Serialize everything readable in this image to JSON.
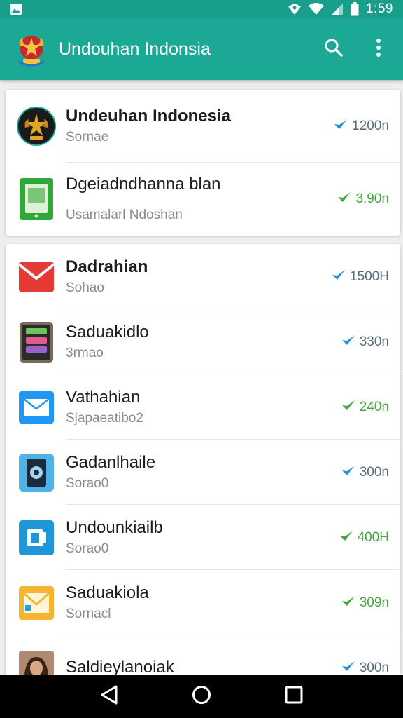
{
  "status_bar": {
    "time": "1:59"
  },
  "app_bar": {
    "title": "Undouhan Indonsia",
    "actions": [
      "search-icon",
      "more-vert-icon"
    ]
  },
  "colors": {
    "app_bar": "#1ba995",
    "status_bar": "#1a9e8c",
    "blue_check": "#2b8fd6",
    "green_check": "#43a53a"
  },
  "card_1": {
    "items": [
      {
        "title": "Undeuhan Indonesia",
        "subtitle": "Sornae",
        "meta": "1200n",
        "status": "blue",
        "icon": "emblem-icon"
      },
      {
        "title": "Dgeiadndhanna blan",
        "subtitle": "Usamalarl Ndoshan",
        "meta": "3.90n",
        "status": "green",
        "icon": "phone-app-icon"
      }
    ]
  },
  "card_2": {
    "items": [
      {
        "title": "Dadrahian",
        "subtitle": "Sohao",
        "meta": "1500H",
        "status": "blue",
        "icon": "mail-red-icon"
      },
      {
        "title": "Saduakidlo",
        "subtitle": "3rmao",
        "meta": "330n",
        "status": "blue",
        "icon": "tablet-app-icon"
      },
      {
        "title": "Vathahian",
        "subtitle": "Sjapaeatibo2",
        "meta": "240n",
        "status": "green",
        "icon": "mail-blue-icon"
      },
      {
        "title": "Gadanlhaile",
        "subtitle": "Sorao0",
        "meta": "300n",
        "status": "blue",
        "icon": "phone-blue-icon"
      },
      {
        "title": "Undounkiailb",
        "subtitle": "Soraо0",
        "meta": "400H",
        "status": "green",
        "icon": "square-blue-icon"
      },
      {
        "title": "Saduakiola",
        "subtitle": "Sornacl",
        "meta": "309n",
        "status": "green",
        "icon": "mail-yellow-icon"
      },
      {
        "title": "Saldieylanoiak",
        "subtitle": "",
        "meta": "300n",
        "status": "blue",
        "icon": "avatar-photo-icon"
      }
    ]
  }
}
